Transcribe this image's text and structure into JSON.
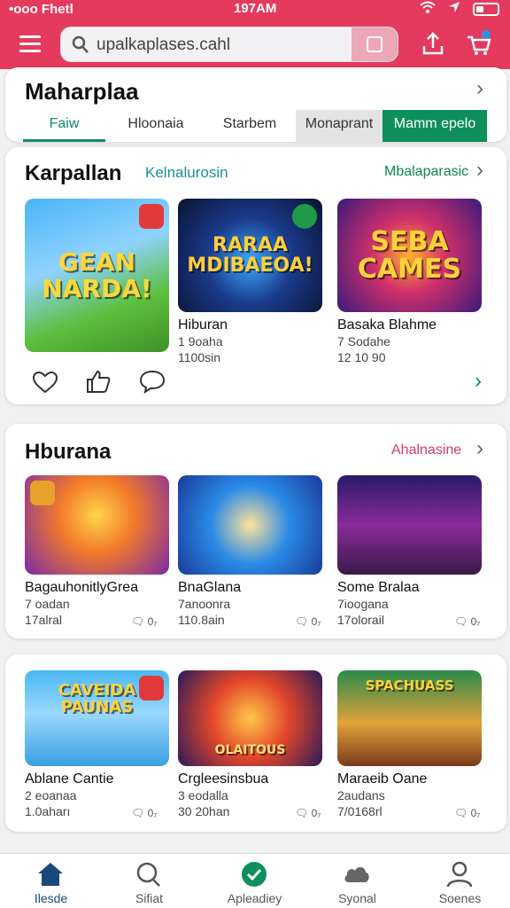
{
  "status_bar": {
    "carrier": "•ooo Fhetl",
    "time": "197AM"
  },
  "search": {
    "value": "upalkaplases.cahl"
  },
  "promo": {
    "title": "Maharplaa",
    "tabs": [
      "Faiw",
      "Hloonaia",
      "Starbem",
      "Monaprant",
      "Mamm epelo"
    ]
  },
  "section1": {
    "title": "Karpallan",
    "subtitle": "Kelnalurosin",
    "link": "Mbalaparasic",
    "games": [
      {
        "art": "GEAN NARDA!",
        "name": "",
        "line1": "",
        "line2": ""
      },
      {
        "art": "RARAA MDIBAEOA!",
        "name": "Hiburan",
        "line1": "1 9oaha",
        "line2": "1100sin"
      },
      {
        "art": "SEBA CAMES",
        "name": "Basaka Blahme",
        "line1": "7 Sodahe",
        "line2": "12 10 90"
      }
    ]
  },
  "section2": {
    "title": "Hburana",
    "link": "Ahalnasine",
    "games": [
      {
        "name": "BagauhonitlyGrea",
        "line1": "7 oadan",
        "line2": "17alral",
        "count": "0₇"
      },
      {
        "name": "BnaGlana",
        "line1": "7anoonra",
        "line2": "110.8ain",
        "count": "0₇"
      },
      {
        "name": "Some Bralaa",
        "line1": "7ioogana",
        "line2": "17olorail",
        "count": "0₇"
      }
    ]
  },
  "section3": {
    "games": [
      {
        "art": "CAVEIDA PAUNAS",
        "name": "Ablane Cantie",
        "line1": "2 eoanaa",
        "line2": "1.0aharı",
        "count": "0₇"
      },
      {
        "art": "OLAITOUS",
        "name": "Crgleesinsbua",
        "line1": "3 eodalla",
        "line2": "30 20han",
        "count": "0₇"
      },
      {
        "art": "SPACHUASS",
        "name": "Maraeib Oane",
        "line1": "2audans",
        "line2": "7/0168rl",
        "count": "0₇"
      }
    ]
  },
  "bottom_nav": [
    "Ilesde",
    "Sifiat",
    "Apleadiey",
    "Syonal",
    "Soenes"
  ],
  "colors": {
    "primary": "#e43a5e",
    "accent": "#0f8a70",
    "green": "#0f8f5a",
    "link_pink": "#d23c6c",
    "link_teal": "#1b8f9a"
  },
  "icons": [
    "menu-icon",
    "search-icon",
    "scan-icon",
    "upload-icon",
    "cart-icon",
    "heart-icon",
    "thumbs-up-icon",
    "chat-icon",
    "home-icon",
    "check-icon",
    "cloud-icon",
    "profile-icon"
  ]
}
